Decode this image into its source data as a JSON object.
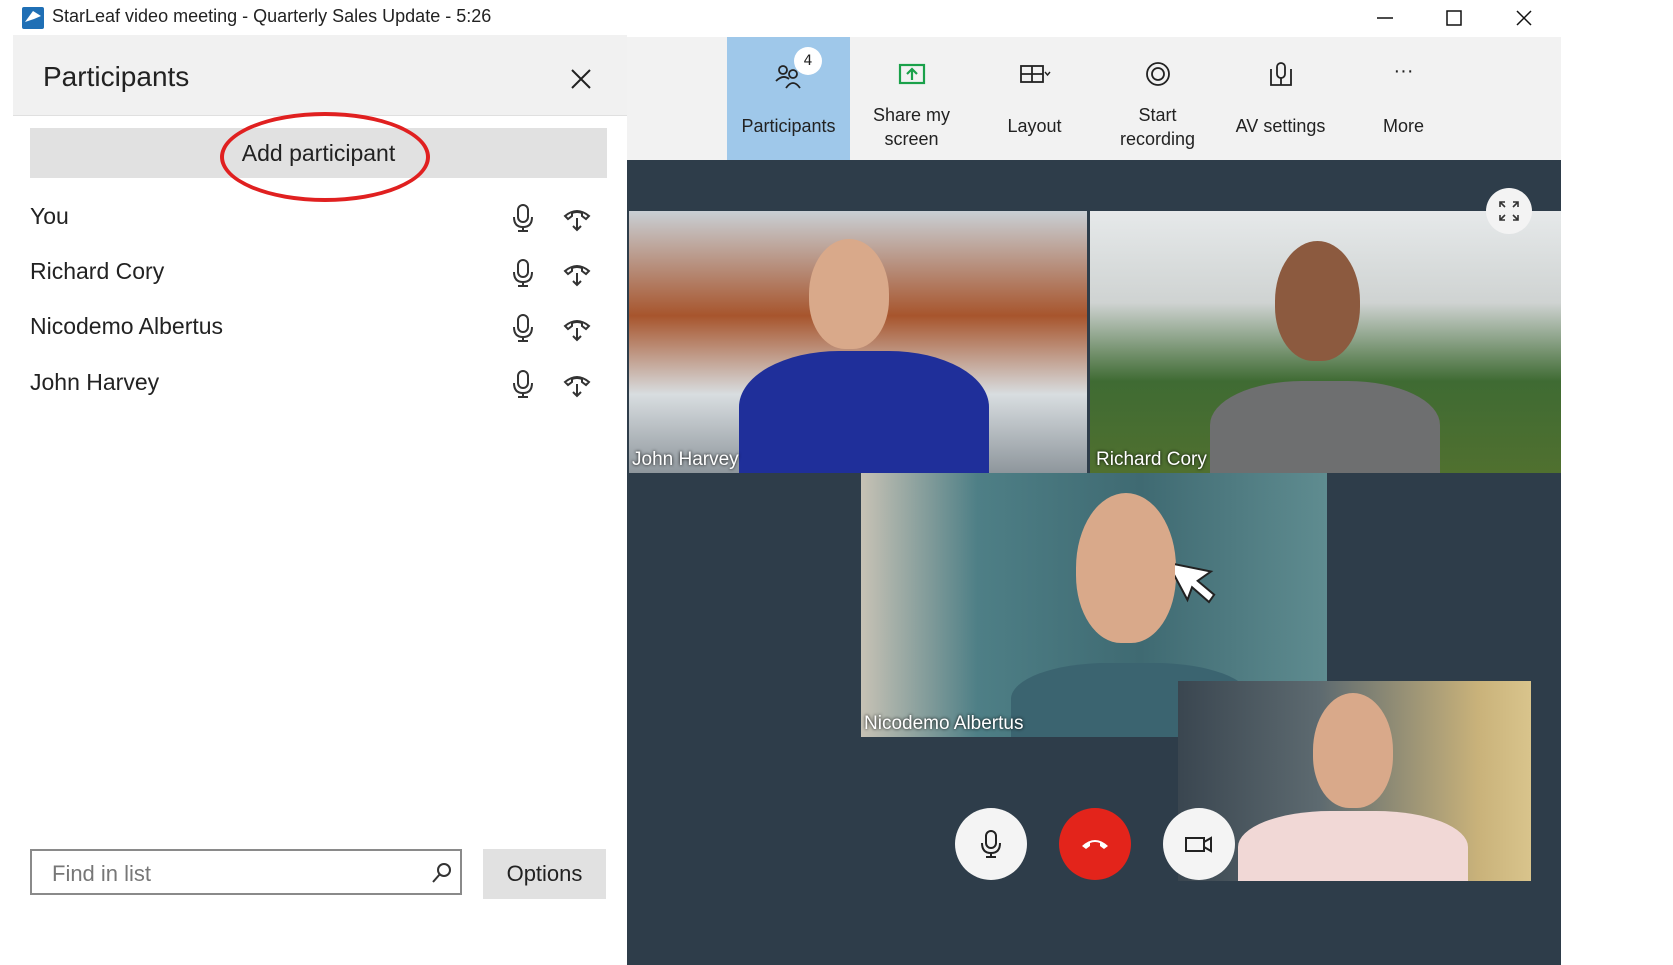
{
  "window": {
    "title": "StarLeaf video meeting - Quarterly Sales Update - 5:26",
    "controls": {
      "minimize": "—",
      "maximize": "☐",
      "close": "✕"
    }
  },
  "panel": {
    "title": "Participants",
    "add_button": "Add participant",
    "participants": [
      {
        "name": "You"
      },
      {
        "name": "Richard Cory"
      },
      {
        "name": "Nicodemo Albertus"
      },
      {
        "name": "John Harvey"
      }
    ],
    "search": {
      "placeholder": "Find in list",
      "value": ""
    },
    "options_button": "Options"
  },
  "toolbar": {
    "participants": {
      "label": "Participants",
      "badge": "4",
      "active": true
    },
    "share": {
      "label_line1": "Share my",
      "label_line2": "screen"
    },
    "layout": {
      "label": "Layout"
    },
    "recording": {
      "label_line1": "Start",
      "label_line2": "recording"
    },
    "av": {
      "label": "AV settings"
    },
    "more": {
      "label": "More",
      "icon": "···"
    }
  },
  "videos": [
    {
      "name": "John Harvey"
    },
    {
      "name": "Richard Cory"
    },
    {
      "name": "Nicodemo Albertus"
    }
  ],
  "colors": {
    "accent_active": "#9fc8ea",
    "hangup": "#e3241b",
    "share_icon": "#1aa14a",
    "highlight_circle": "#e02020",
    "video_bg": "#2e3d4a"
  }
}
